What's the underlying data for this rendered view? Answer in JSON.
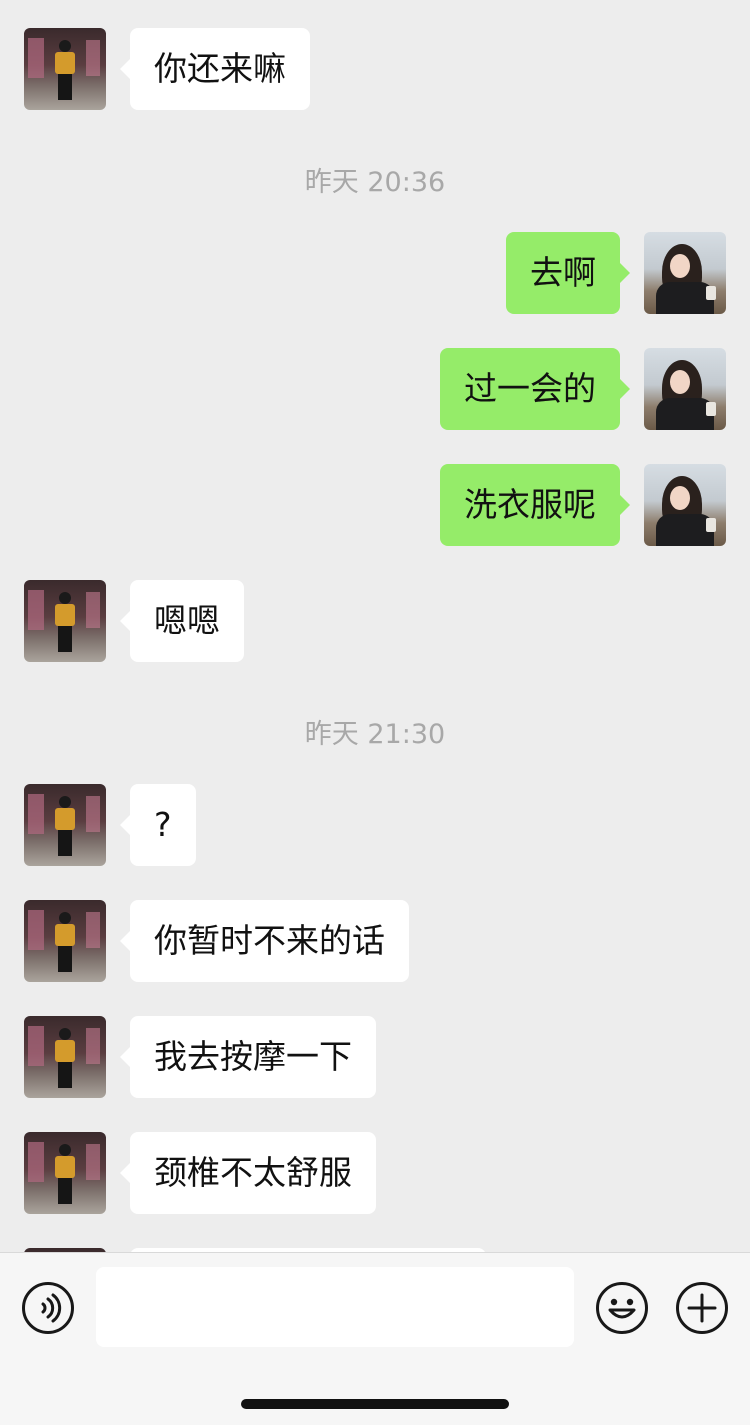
{
  "chat": {
    "messages": [
      {
        "side": "left",
        "text": "你还来嘛"
      },
      {
        "timestamp": "昨天 20:36"
      },
      {
        "side": "right",
        "text": "去啊"
      },
      {
        "side": "right",
        "text": "过一会的"
      },
      {
        "side": "right",
        "text": "洗衣服呢"
      },
      {
        "side": "left",
        "text": "嗯嗯"
      },
      {
        "timestamp": "昨天 21:30"
      },
      {
        "side": "left",
        "text": "?"
      },
      {
        "side": "left",
        "text": "你暂时不来的话"
      },
      {
        "side": "left",
        "text": "我去按摩一下"
      },
      {
        "side": "left",
        "text": "颈椎不太舒服"
      }
    ]
  },
  "colors": {
    "background": "#ededed",
    "outgoing_bubble": "#95ec69",
    "incoming_bubble": "#ffffff",
    "timestamp_text": "#a8a8a8"
  },
  "input_bar": {
    "message_value": "",
    "icons": [
      "voice-icon",
      "emoji-icon",
      "plus-icon"
    ]
  }
}
